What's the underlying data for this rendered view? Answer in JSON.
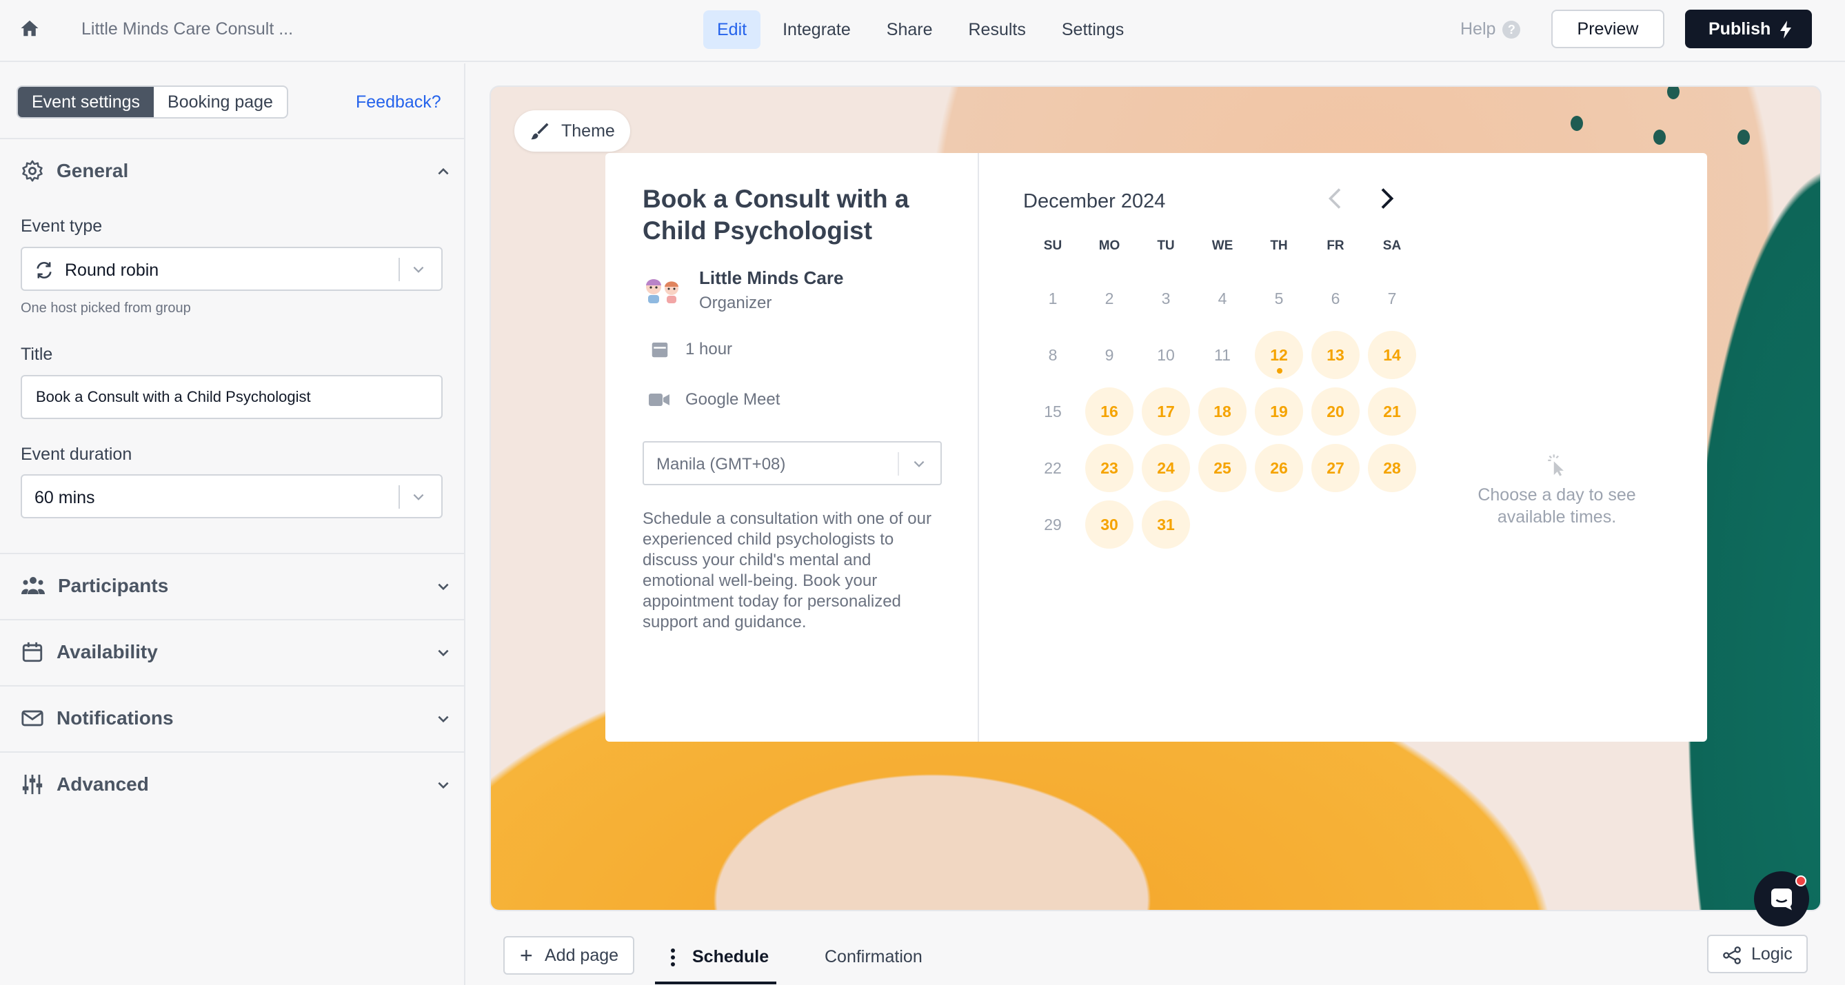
{
  "topbar": {
    "doc_title": "Little Minds Care Consult ...",
    "nav": [
      "Edit",
      "Integrate",
      "Share",
      "Results",
      "Settings"
    ],
    "active_nav": "Edit",
    "help": "Help",
    "preview": "Preview",
    "publish": "Publish"
  },
  "left_panel": {
    "segments": [
      "Event settings",
      "Booking page"
    ],
    "active_segment": "Event settings",
    "feedback": "Feedback?",
    "general": {
      "heading": "General",
      "event_type_label": "Event type",
      "event_type_value": "Round robin",
      "event_type_hint": "One host picked from group",
      "title_label": "Title",
      "title_value": "Book a Consult with a Child Psychologist",
      "duration_label": "Event duration",
      "duration_value": "60 mins"
    },
    "sections": {
      "participants": "Participants",
      "availability": "Availability",
      "notifications": "Notifications",
      "advanced": "Advanced"
    }
  },
  "canvas": {
    "theme_button": "Theme",
    "event": {
      "title": "Book a Consult with a Child Psychologist",
      "organizer_name": "Little Minds Care",
      "organizer_role": "Organizer",
      "duration": "1 hour",
      "location": "Google Meet",
      "timezone": "Manila (GMT+08)",
      "description": "Schedule a consultation with one of our experienced child psychologists to discuss your child's mental and emotional well-being. Book your appointment today for personalized support and guidance."
    },
    "calendar": {
      "month": "December 2024",
      "weekdays": [
        "SU",
        "MO",
        "TU",
        "WE",
        "TH",
        "FR",
        "SA"
      ],
      "weeks": [
        [
          "1",
          "2",
          "3",
          "4",
          "5",
          "6",
          "7"
        ],
        [
          "8",
          "9",
          "10",
          "11",
          "12",
          "13",
          "14"
        ],
        [
          "15",
          "16",
          "17",
          "18",
          "19",
          "20",
          "21"
        ],
        [
          "22",
          "23",
          "24",
          "25",
          "26",
          "27",
          "28"
        ],
        [
          "29",
          "30",
          "31"
        ]
      ],
      "available_days": [
        "12",
        "13",
        "14",
        "16",
        "17",
        "18",
        "19",
        "20",
        "21",
        "23",
        "24",
        "25",
        "26",
        "27",
        "28",
        "30",
        "31"
      ],
      "today": "12",
      "empty_hint": "Choose a day to see available times."
    }
  },
  "bottombar": {
    "add_page": "Add page",
    "tabs": [
      "Schedule",
      "Confirmation"
    ],
    "active_tab": "Schedule",
    "logic": "Logic"
  },
  "colors": {
    "accent_blue": "#2563eb",
    "available_day": "#f5a300",
    "publish_bg": "#111827"
  }
}
